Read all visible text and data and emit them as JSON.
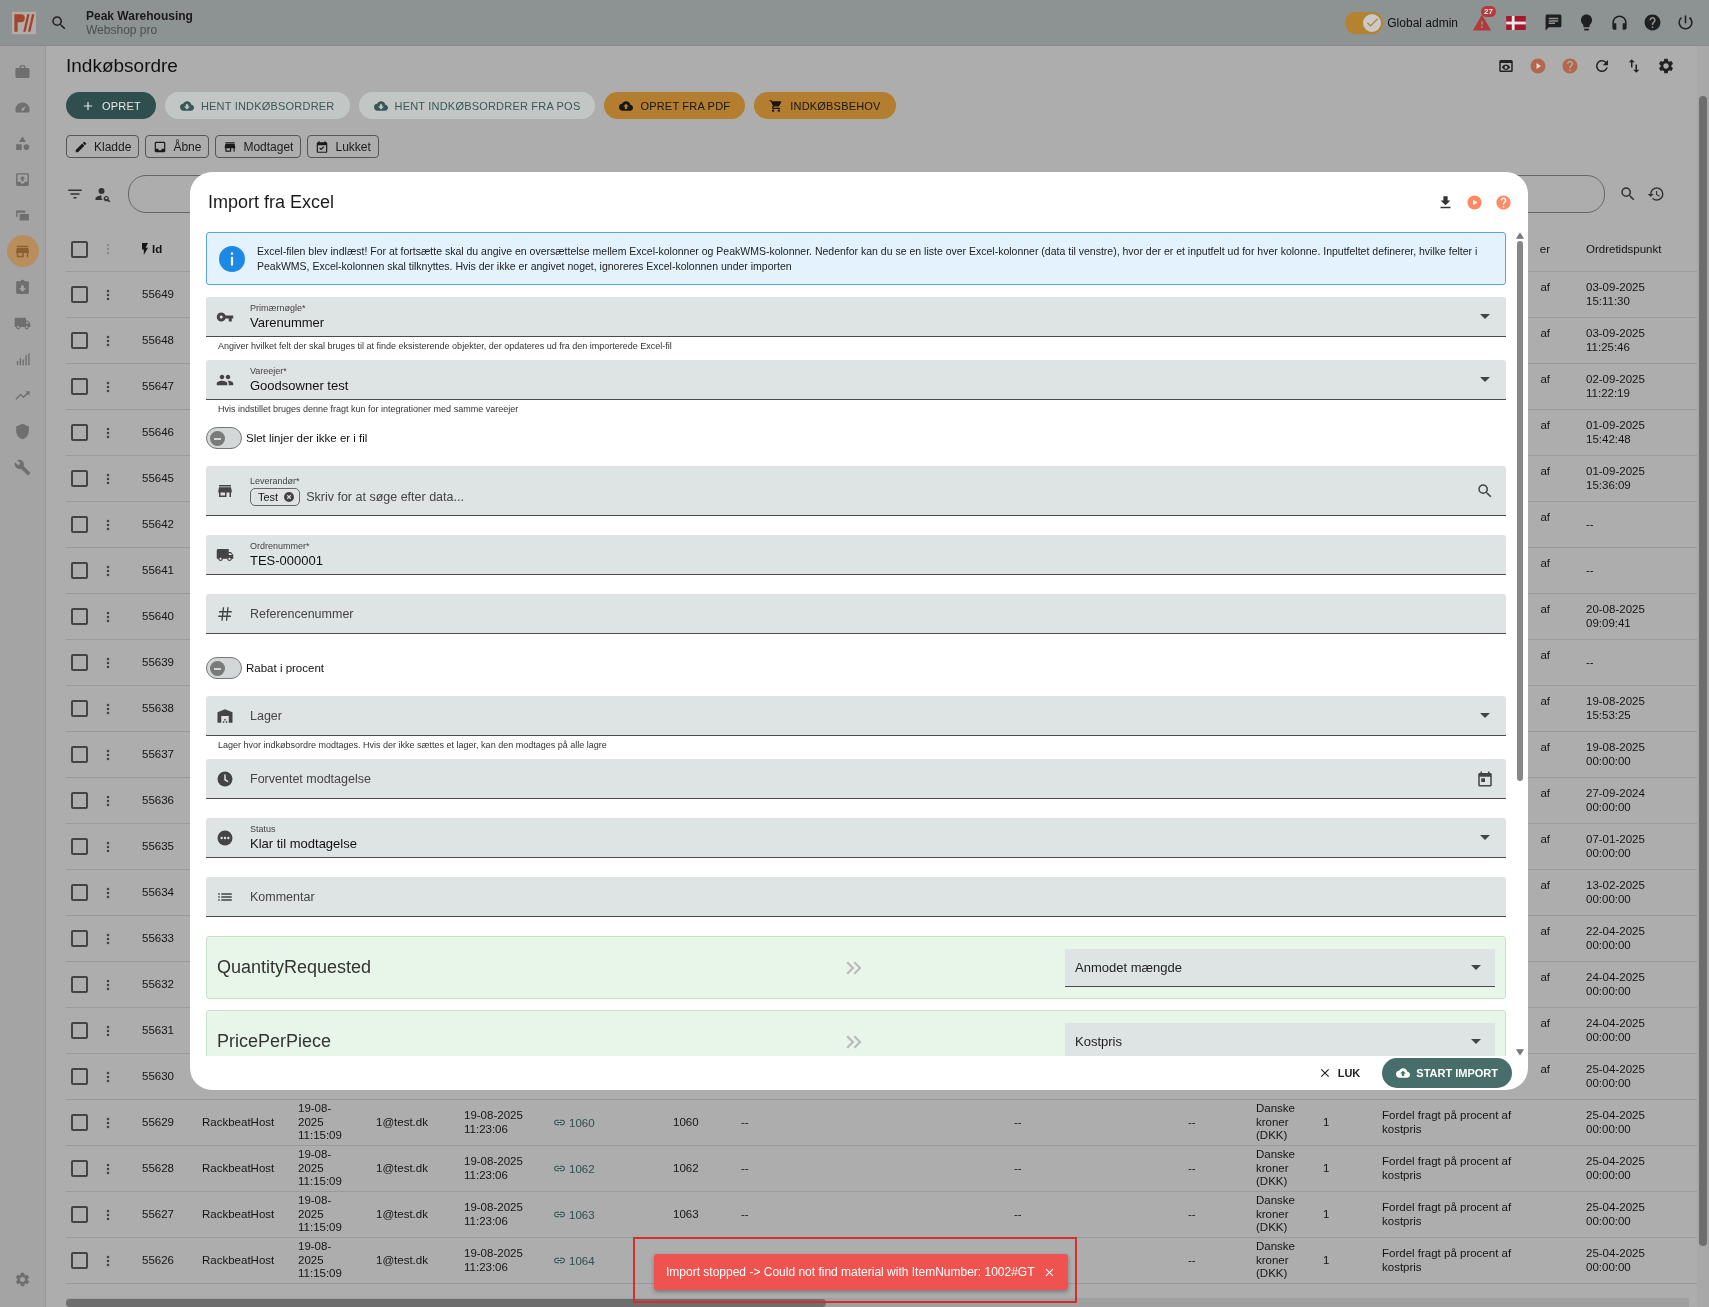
{
  "topbar": {
    "company": "Peak Warehousing",
    "product": "Webshop pro",
    "admin_toggle": {
      "label": "Global admin",
      "on": true
    },
    "alert_count": "27"
  },
  "sidebar": {
    "items": [
      {
        "selected": false
      },
      {
        "selected": false
      },
      {
        "selected": false
      },
      {
        "selected": false
      },
      {
        "selected": false
      },
      {
        "selected": true
      },
      {
        "selected": false
      },
      {
        "selected": false
      },
      {
        "selected": false
      },
      {
        "selected": false
      },
      {
        "selected": false
      },
      {
        "selected": false
      }
    ],
    "footer_items": [
      {
        "selected": false
      }
    ]
  },
  "page": {
    "title": "Indkøbsordre"
  },
  "actions": [
    {
      "label": "OPRET",
      "kind": "primary"
    },
    {
      "label": "HENT INDKØBSORDRER",
      "kind": "secondary"
    },
    {
      "label": "HENT INDKØBSORDRER FRA POS",
      "kind": "secondary"
    },
    {
      "label": "OPRET FRA PDF",
      "kind": "accent"
    },
    {
      "label": "INDKØBSBEHOV",
      "kind": "accent"
    }
  ],
  "status_filters": [
    {
      "label": "Kladde",
      "selected": false
    },
    {
      "label": "Åbne",
      "selected": false
    },
    {
      "label": "Modtaget",
      "selected": false
    },
    {
      "label": "Lukket",
      "selected": false
    }
  ],
  "table": {
    "header": {
      "checked": false,
      "id": "Id",
      "column_13": "er",
      "ordretidspunkt": "Ordretidspunkt"
    },
    "rows": [
      {
        "checked": false,
        "id": "55649",
        "column_13": "af",
        "ordretidspunkt": "03-09-2025 15:11:30"
      },
      {
        "checked": false,
        "id": "55648",
        "column_13": "af",
        "ordretidspunkt": "03-09-2025 11:25:46"
      },
      {
        "checked": false,
        "id": "55647",
        "column_13": "af",
        "ordretidspunkt": "02-09-2025 11:22:19"
      },
      {
        "checked": false,
        "id": "55646",
        "column_13": "af",
        "ordretidspunkt": "01-09-2025 15:42:48"
      },
      {
        "checked": false,
        "id": "55645",
        "column_13": "af",
        "ordretidspunkt": "01-09-2025 15:36:09"
      },
      {
        "checked": false,
        "id": "55642",
        "column_13": "af",
        "ordretidspunkt": "--"
      },
      {
        "checked": false,
        "id": "55641",
        "column_13": "af",
        "ordretidspunkt": "--"
      },
      {
        "checked": false,
        "id": "55640",
        "column_13": "af",
        "ordretidspunkt": "20-08-2025 09:09:41"
      },
      {
        "checked": false,
        "id": "55639",
        "column_13": "af",
        "ordretidspunkt": "--"
      },
      {
        "checked": false,
        "id": "55638",
        "column_13": "af",
        "ordretidspunkt": "19-08-2025 15:53:25"
      },
      {
        "checked": false,
        "id": "55637",
        "column_13": "af",
        "ordretidspunkt": "19-08-2025 00:00:00"
      },
      {
        "checked": false,
        "id": "55636",
        "column_13": "af",
        "ordretidspunkt": "27-09-2024 00:00:00"
      },
      {
        "checked": false,
        "id": "55635",
        "column_13": "af",
        "ordretidspunkt": "07-01-2025 00:00:00"
      },
      {
        "checked": false,
        "id": "55634",
        "column_13": "af",
        "ordretidspunkt": "13-02-2025 00:00:00"
      },
      {
        "checked": false,
        "id": "55633",
        "column_13": "af",
        "ordretidspunkt": "22-04-2025 00:00:00"
      },
      {
        "checked": false,
        "id": "55632",
        "column_13": "af",
        "ordretidspunkt": "24-04-2025 00:00:00"
      },
      {
        "checked": false,
        "id": "55631",
        "column_13": "af",
        "ordretidspunkt": "24-04-2025 00:00:00"
      },
      {
        "checked": false,
        "id": "55630",
        "column_13": "af",
        "ordretidspunkt": "25-04-2025 00:00:00"
      },
      {
        "checked": false,
        "id": "55629",
        "column_2": "RackbeatHost",
        "column_3": "19-08-2025 11:15:09",
        "column_4": "1@test.dk",
        "column_5": "19-08-2025 11:23:06",
        "column_6": "1060",
        "column_7": "1060",
        "column_8": "--",
        "column_9": "--",
        "column_10": "--",
        "column_11": "Danske kroner (DKK)",
        "column_12": "1",
        "column_13": "Fordel fragt på procent af kostpris",
        "ordretidspunkt": "25-04-2025 00:00:00"
      },
      {
        "checked": false,
        "id": "55628",
        "column_2": "RackbeatHost",
        "column_3": "19-08-2025 11:15:09",
        "column_4": "1@test.dk",
        "column_5": "19-08-2025 11:23:06",
        "column_6": "1062",
        "column_7": "1062",
        "column_8": "--",
        "column_9": "--",
        "column_10": "--",
        "column_11": "Danske kroner (DKK)",
        "column_12": "1",
        "column_13": "Fordel fragt på procent af kostpris",
        "ordretidspunkt": "25-04-2025 00:00:00"
      },
      {
        "checked": false,
        "id": "55627",
        "column_2": "RackbeatHost",
        "column_3": "19-08-2025 11:15:09",
        "column_4": "1@test.dk",
        "column_5": "19-08-2025 11:23:06",
        "column_6": "1063",
        "column_7": "1063",
        "column_8": "--",
        "column_9": "--",
        "column_10": "--",
        "column_11": "Danske kroner (DKK)",
        "column_12": "1",
        "column_13": "Fordel fragt på procent af kostpris",
        "ordretidspunkt": "25-04-2025 00:00:00"
      },
      {
        "checked": false,
        "id": "55626",
        "column_2": "RackbeatHost",
        "column_3": "19-08-2025 11:15:09",
        "column_4": "1@test.dk",
        "column_5": "19-08-2025 11:23:06",
        "column_6": "1064",
        "column_10": "--",
        "column_11": "Danske kroner (DKK)",
        "column_12": "1",
        "column_13": "Fordel fragt på procent af kostpris",
        "ordretidspunkt": "25-04-2025 00:00:00"
      }
    ]
  },
  "modal": {
    "title": "Import fra Excel",
    "info": "Excel-filen blev indlæst! For at fortsætte skal du angive en oversættelse mellem Excel-kolonner og PeakWMS-kolonner. Nedenfor kan du se en liste over Excel-kolonner (data til venstre), hvor der er et inputfelt ud for hver kolonne. Inputfeltet definerer, hvilke felter i PeakWMS, Excel-kolonnen skal tilknyttes. Hvis der ikke er angivet noget, ignoreres Excel-kolonnen under importen",
    "fields": [
      {
        "kind": "select",
        "label": "Primærnøgle*",
        "value": "Varenummer",
        "hint": "Angiver hvilket felt der skal bruges til at finde eksisterende objekter, der opdateres ud fra den importerede Excel-fil"
      },
      {
        "kind": "select",
        "label": "Vareejer*",
        "value": "Goodsowner test",
        "hint": "Hvis indstillet bruges denne fragt kun for integrationer med samme vareejer"
      },
      {
        "kind": "toggle",
        "label": "Slet linjer der ikke er i fil",
        "on": false
      },
      {
        "kind": "autocomplete",
        "label": "Leverandør*",
        "chips": [
          "Test"
        ],
        "placeholder": "Skriv for at søge efter data..."
      },
      {
        "kind": "text",
        "label": "Ordrenummer*",
        "value": "TES-000001"
      },
      {
        "kind": "text",
        "placeholder": "Referencenummer"
      },
      {
        "kind": "toggle",
        "label": "Rabat i procent",
        "on": false
      },
      {
        "kind": "select",
        "placeholder": "Lager",
        "hint": "Lager hvor indkøbsordre modtages. Hvis der ikke sættes et lager, kan den modtages på alle lagre"
      },
      {
        "kind": "date",
        "placeholder": "Forventet modtagelse"
      },
      {
        "kind": "select",
        "label": "Status",
        "value": "Klar til modtagelse"
      },
      {
        "kind": "text",
        "placeholder": "Kommentar"
      }
    ],
    "mappings": [
      {
        "column": "QuantityRequested",
        "target": "Anmodet mængde"
      },
      {
        "column": "PricePerPiece",
        "target": "Kostpris"
      }
    ],
    "buttons": [
      {
        "label": "LUK",
        "kind": "text"
      },
      {
        "label": "START IMPORT",
        "kind": "primary"
      }
    ]
  },
  "toast": {
    "message": "Import stopped -> Could not find material with ItemNumber: 1002#GT"
  }
}
